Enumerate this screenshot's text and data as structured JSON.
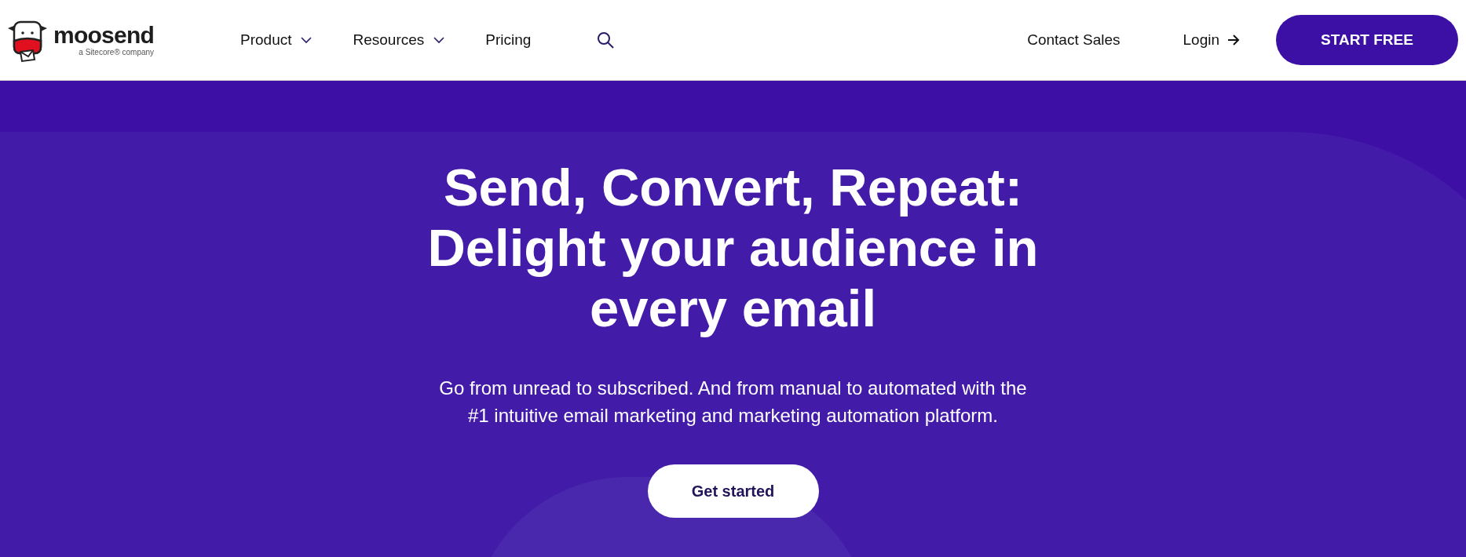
{
  "header": {
    "logo": {
      "name": "moosend",
      "tagline": "a Sitecore® company"
    },
    "nav": [
      {
        "label": "Product",
        "dropdown": true
      },
      {
        "label": "Resources",
        "dropdown": true
      },
      {
        "label": "Pricing",
        "dropdown": false
      }
    ],
    "contact": "Contact Sales",
    "login": "Login",
    "cta": "START FREE"
  },
  "hero": {
    "title_lines": [
      "Send, Convert, Repeat:",
      "Delight your audience in",
      "every email"
    ],
    "subtitle_lines": [
      "Go from unread to subscribed. And from manual to automated with the",
      "#1 intuitive email marketing and marketing automation platform."
    ],
    "button": "Get started"
  }
}
